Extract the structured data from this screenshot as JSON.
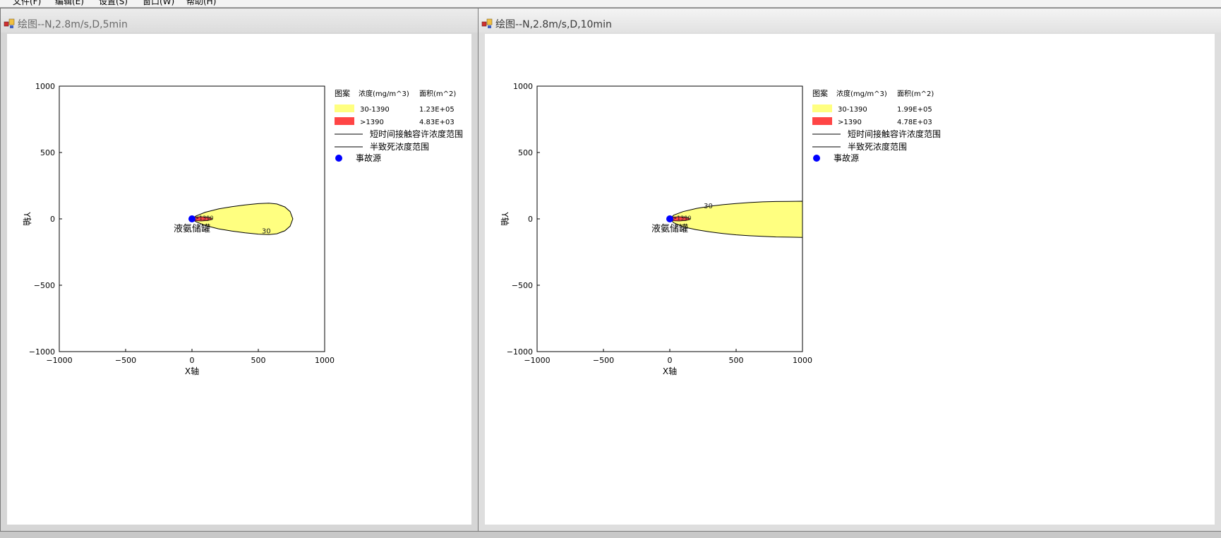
{
  "menu": {
    "items": [
      "文件(F)",
      "编辑(E)",
      "设置(S)",
      "窗口(W)",
      "帮助(H)"
    ]
  },
  "windows": [
    {
      "title": "绘图--N,2.8m/s,D,5min",
      "active": false,
      "chart": {
        "xlabel": "X轴",
        "ylabel": "Y轴",
        "xlim": [
          -1000,
          1000
        ],
        "ylim": [
          -1000,
          1000
        ],
        "xticks": [
          -1000,
          -500,
          0,
          500,
          1000
        ],
        "yticks": [
          -1000,
          -500,
          0,
          500,
          1000
        ],
        "plume_outer": {
          "label": "30",
          "points": [
            [
              0,
              0
            ],
            [
              30,
              22
            ],
            [
              100,
              50
            ],
            [
              200,
              75
            ],
            [
              300,
              92
            ],
            [
              400,
              105
            ],
            [
              500,
              115
            ],
            [
              580,
              118
            ],
            [
              640,
              112
            ],
            [
              700,
              90
            ],
            [
              740,
              55
            ],
            [
              760,
              0
            ],
            [
              740,
              -55
            ],
            [
              700,
              -90
            ],
            [
              640,
              -112
            ],
            [
              580,
              -118
            ],
            [
              500,
              -115
            ],
            [
              400,
              -105
            ],
            [
              300,
              -92
            ],
            [
              200,
              -75
            ],
            [
              100,
              -50
            ],
            [
              30,
              -22
            ]
          ]
        },
        "plume_inner": {
          "label": ">1390",
          "points": [
            [
              0,
              0
            ],
            [
              20,
              14
            ],
            [
              70,
              16
            ],
            [
              120,
              12
            ],
            [
              150,
              5
            ],
            [
              150,
              -5
            ],
            [
              120,
              -12
            ],
            [
              70,
              -16
            ],
            [
              20,
              -14
            ]
          ]
        },
        "source": {
          "x": 0,
          "y": 0,
          "label": "液氨储罐"
        }
      },
      "legend": {
        "header": [
          "图案",
          "浓度(mg/m^3)",
          "面积(m^2)"
        ],
        "rows": [
          {
            "swatch": "#ffff80",
            "range": "30-1390",
            "area": "1.23E+05"
          },
          {
            "swatch": "#ff4545",
            "range": ">1390",
            "area": "4.83E+03"
          }
        ],
        "lines": [
          "短时间接触容许浓度范围",
          "半致死浓度范围"
        ],
        "dot": "事故源"
      }
    },
    {
      "title": "绘图--N,2.8m/s,D,10min",
      "active": true,
      "chart": {
        "xlabel": "X轴",
        "ylabel": "Y轴",
        "xlim": [
          -1000,
          1000
        ],
        "ylim": [
          -1000,
          1000
        ],
        "xticks": [
          -1000,
          -500,
          0,
          500,
          1000
        ],
        "yticks": [
          -1000,
          -500,
          0,
          500,
          1000
        ],
        "plume_outer": {
          "label": "30",
          "points": [
            [
              0,
              0
            ],
            [
              30,
              28
            ],
            [
              100,
              55
            ],
            [
              200,
              78
            ],
            [
              300,
              95
            ],
            [
              400,
              107
            ],
            [
              500,
              116
            ],
            [
              600,
              123
            ],
            [
              700,
              128
            ],
            [
              800,
              131
            ],
            [
              900,
              132
            ],
            [
              1000,
              133
            ],
            [
              1000,
              -140
            ],
            [
              900,
              -138
            ],
            [
              800,
              -136
            ],
            [
              700,
              -132
            ],
            [
              600,
              -127
            ],
            [
              500,
              -120
            ],
            [
              400,
              -110
            ],
            [
              300,
              -98
            ],
            [
              200,
              -82
            ],
            [
              100,
              -60
            ],
            [
              30,
              -30
            ]
          ]
        },
        "plume_inner": {
          "label": ">1390",
          "points": [
            [
              0,
              0
            ],
            [
              20,
              14
            ],
            [
              70,
              16
            ],
            [
              120,
              12
            ],
            [
              150,
              5
            ],
            [
              150,
              -5
            ],
            [
              120,
              -12
            ],
            [
              70,
              -16
            ],
            [
              20,
              -14
            ]
          ]
        },
        "source": {
          "x": 0,
          "y": 0,
          "label": "液氨储罐"
        }
      },
      "legend": {
        "header": [
          "图案",
          "浓度(mg/m^3)",
          "面积(m^2)"
        ],
        "rows": [
          {
            "swatch": "#ffff80",
            "range": "30-1390",
            "area": "1.99E+05"
          },
          {
            "swatch": "#ff4545",
            "range": ">1390",
            "area": "4.78E+03"
          }
        ],
        "lines": [
          "短时间接触容许浓度范围",
          "半致死浓度范围"
        ],
        "dot": "事故源"
      }
    }
  ],
  "chart_data": [
    {
      "type": "area",
      "title": "绘图--N,2.8m/s,D,5min",
      "xlabel": "X轴",
      "ylabel": "Y轴",
      "xlim": [
        -1000,
        1000
      ],
      "ylim": [
        -1000,
        1000
      ],
      "series": [
        {
          "name": "30-1390",
          "area": "1.23E+05"
        },
        {
          "name": ">1390",
          "area": "4.83E+03"
        }
      ],
      "annotations": [
        "30",
        ">1390",
        "液氨储罐"
      ],
      "source_point": [
        0,
        0
      ]
    },
    {
      "type": "area",
      "title": "绘图--N,2.8m/s,D,10min",
      "xlabel": "X轴",
      "ylabel": "Y轴",
      "xlim": [
        -1000,
        1000
      ],
      "ylim": [
        -1000,
        1000
      ],
      "series": [
        {
          "name": "30-1390",
          "area": "1.99E+05"
        },
        {
          "name": ">1390",
          "area": "4.78E+03"
        }
      ],
      "annotations": [
        "30",
        ">1390",
        "液氨储罐"
      ],
      "source_point": [
        0,
        0
      ]
    }
  ]
}
